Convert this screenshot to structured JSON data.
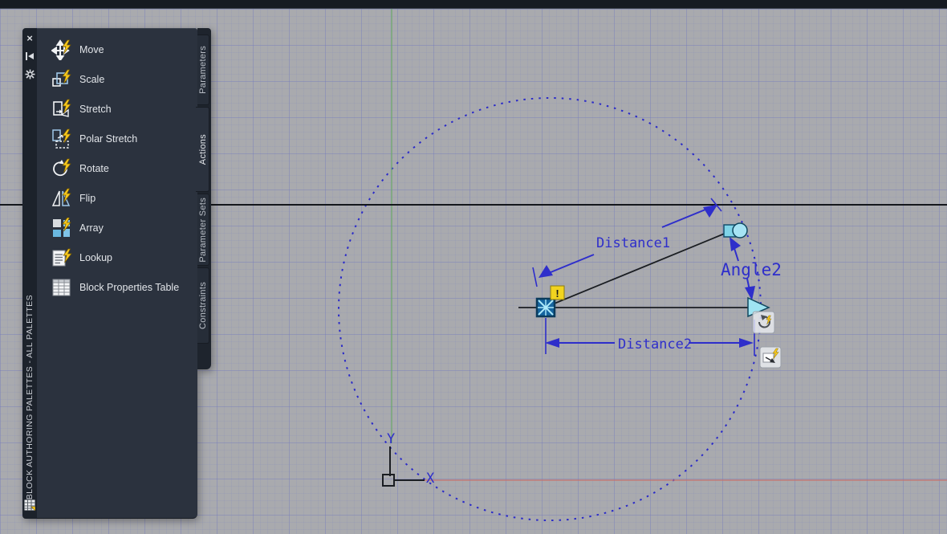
{
  "app": "AutoCAD Block Editor",
  "palette": {
    "title": "BLOCK AUTHORING PALETTES - ALL PALETTES",
    "titlebar_icons": {
      "close_glyph": "×"
    },
    "tools": [
      {
        "label": "Move",
        "icon": "move-icon"
      },
      {
        "label": "Scale",
        "icon": "scale-icon"
      },
      {
        "label": "Stretch",
        "icon": "stretch-icon"
      },
      {
        "label": "Polar Stretch",
        "icon": "polar-stretch-icon"
      },
      {
        "label": "Rotate",
        "icon": "rotate-icon"
      },
      {
        "label": "Flip",
        "icon": "flip-icon"
      },
      {
        "label": "Array",
        "icon": "array-icon"
      },
      {
        "label": "Lookup",
        "icon": "lookup-icon"
      },
      {
        "label": "Block Properties Table",
        "icon": "block-properties-table-icon"
      }
    ],
    "tabs": [
      {
        "label": "Parameters",
        "active": false
      },
      {
        "label": "Actions",
        "active": true
      },
      {
        "label": "Parameter Sets",
        "active": false
      },
      {
        "label": "Constraints",
        "active": false
      }
    ]
  },
  "canvas": {
    "labels": {
      "distance1": "Distance1",
      "angle2": "Angle2",
      "distance2": "Distance2",
      "axis_x": "X",
      "axis_y": "Y"
    },
    "warning_glyph": "!",
    "colors": {
      "dimension_blue": "#2e2ecb",
      "grip_cyan": "#8fdcf0",
      "warning_yellow": "#f2d41f",
      "axis_green": "#6aa86a",
      "axis_red": "#c8706a",
      "geometry_black": "#1a1d22",
      "canvas_gray": "#a9aaae",
      "palette_dark": "#2b323e"
    }
  }
}
